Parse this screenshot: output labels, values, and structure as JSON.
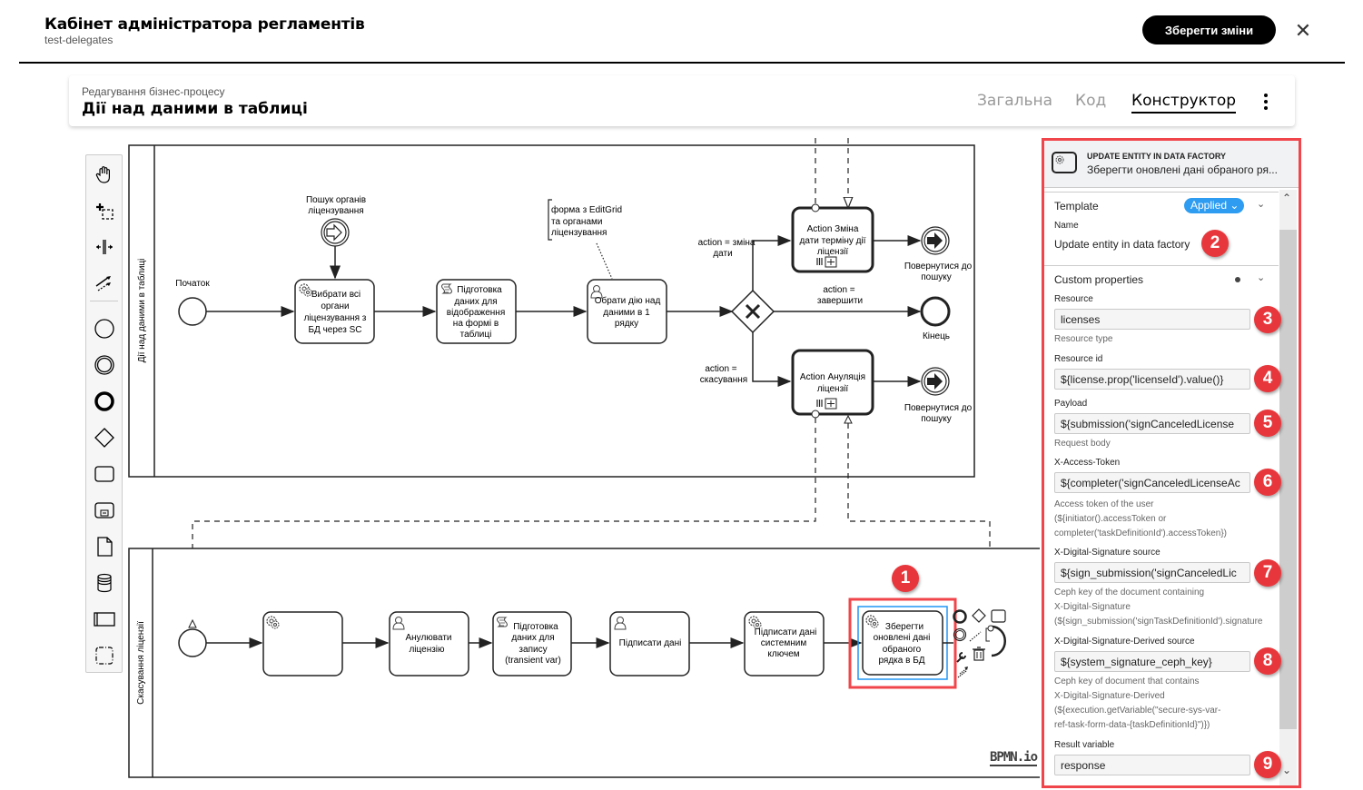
{
  "header": {
    "app_title": "Кабінет адміністратора регламентів",
    "app_subtitle": "test-delegates",
    "save_label": "Зберегти зміни",
    "close_icon": "close-icon"
  },
  "card": {
    "subtitle": "Редагування бізнес-процесу",
    "title": "Дії над даними в таблиці",
    "tabs": [
      {
        "label": "Загальна",
        "active": false
      },
      {
        "label": "Код",
        "active": false
      },
      {
        "label": "Конструктор",
        "active": true
      }
    ],
    "more_icon": "kebab-icon"
  },
  "palette": {
    "tools": [
      "hand-tool",
      "lasso-tool",
      "space-tool",
      "global-connect-tool",
      "start-event",
      "intermediate-event",
      "end-event",
      "gateway",
      "task",
      "subprocess",
      "data-object",
      "data-store",
      "pool",
      "group"
    ]
  },
  "diagram": {
    "pool1": {
      "label": "Дії над даними в таблиці",
      "start_label": "Початок",
      "signal_event": "Пошук органів ліцензування",
      "task1": [
        "Вибрати всі",
        "органи",
        "ліцензування з",
        "БД через SC"
      ],
      "task2": [
        "Підготовка",
        "даних для",
        "відображення",
        "на формі в",
        "таблиці"
      ],
      "annotation": [
        "форма з EditGrid",
        "та органами",
        "ліцензування"
      ],
      "task3": [
        "Обрати дію над",
        "даними в 1",
        "рядку"
      ],
      "flow_top": [
        "action = зміна",
        "дати"
      ],
      "flow_mid": [
        "action =",
        "завершити"
      ],
      "flow_bot": [
        "action =",
        "скасування"
      ],
      "sub1": [
        "Action Зміна",
        "дати терміну дії",
        "ліцензії"
      ],
      "sub2": [
        "Action Ануляція",
        "ліцензії"
      ],
      "end_return_1": [
        "Повернутися до",
        "пошуку"
      ],
      "end_label": "Кінець",
      "end_return_2": [
        "Повернутися до",
        "пошуку"
      ]
    },
    "pool2": {
      "label": "Скасування ліцензії",
      "task_a": [],
      "task_b": [
        "Анулювати",
        "ліцензію"
      ],
      "task_c": [
        "Підготовка",
        "даних для",
        "запису",
        "(transient var)"
      ],
      "task_d": [
        "Підписати дані"
      ],
      "task_e": [
        "Підписати дані",
        "системним",
        "ключем"
      ],
      "task_f": [
        "Зберегти",
        "оновлені дані",
        "обраного",
        "рядка в  БД"
      ]
    },
    "watermark": "BPMN.io"
  },
  "properties_panel": {
    "element_type": "UPDATE ENTITY IN DATA FACTORY",
    "element_name": "Зберегти оновлені дані обраного ря...",
    "template": {
      "title": "Template",
      "badge": "Applied",
      "name_label": "Name",
      "name_value": "Update entity in data factory"
    },
    "custom": {
      "title": "Custom properties",
      "fields": [
        {
          "label": "Resource",
          "value": "licenses",
          "hint": [
            "Resource type"
          ]
        },
        {
          "label": "Resource id",
          "value": "${license.prop('licenseId').value()}",
          "hint": []
        },
        {
          "label": "Payload",
          "value": "${submission('signCanceledLicense",
          "hint": [
            "Request body"
          ]
        },
        {
          "label": "X-Access-Token",
          "value": "${completer('signCanceledLicenseAc",
          "hint": [
            "Access token of the user",
            "(${initiator().accessToken or",
            "completer('taskDefinitionId').accessToken})"
          ]
        },
        {
          "label": "X-Digital-Signature source",
          "value": "${sign_submission('signCanceledLic",
          "hint": [
            "Ceph key of the document containing",
            "X-Digital-Signature",
            "(${sign_submission('signTaskDefinitionId').signature"
          ]
        },
        {
          "label": "X-Digital-Signature-Derived source",
          "value": "${system_signature_ceph_key}",
          "hint": [
            "Ceph key of document that contains",
            "X-Digital-Signature-Derived",
            "(${execution.getVariable(\"secure-sys-var-",
            "ref-task-form-data-{taskDefinitionId}\")})"
          ]
        },
        {
          "label": "Result variable",
          "value": "response",
          "hint": []
        }
      ]
    }
  },
  "annotations": {
    "badges": [
      "1",
      "2",
      "3",
      "4",
      "5",
      "6",
      "7",
      "8",
      "9"
    ],
    "color": "#e8373c"
  }
}
